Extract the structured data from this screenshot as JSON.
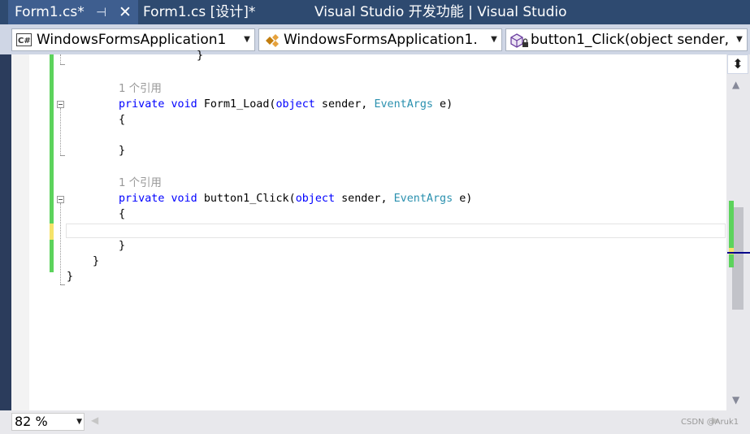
{
  "tabs": [
    {
      "label": "Form1.cs*",
      "active": true
    },
    {
      "label": "Form1.cs [设计]*",
      "active": false
    }
  ],
  "window_title": "Visual Studio 开发功能 | Visual Studio",
  "nav": {
    "project": "WindowsFormsApplication1",
    "class": "WindowsFormsApplication1.",
    "member": "button1_Click(object sender,",
    "project_icon": "csharp-project-icon",
    "class_icon": "class-icon",
    "member_icon": "method-icon"
  },
  "code": {
    "line0": "}",
    "ref1": "1 个引用",
    "load_signature": {
      "modifier": "private",
      "ret": "void",
      "name": "Form1_Load(",
      "param1_type": "object",
      "param1_name": " sender, ",
      "param2_type": "EventArgs",
      "param2_name": " e)"
    },
    "open_brace": "{",
    "close_brace": "}",
    "ref2": "1 个引用",
    "click_signature": {
      "modifier": "private",
      "ret": "void",
      "name": "button1_Click(",
      "param1_type": "object",
      "param1_name": " sender, ",
      "param2_type": "EventArgs",
      "param2_name": " e)"
    }
  },
  "zoom": "82 %",
  "watermark": "CSDN @Aruk1",
  "colors": {
    "keyword": "#0000ff",
    "type": "#2b91af",
    "change_saved": "#5cd35c",
    "change_unsaved": "#f5e36a",
    "tab_active": "#3e5e8f"
  }
}
